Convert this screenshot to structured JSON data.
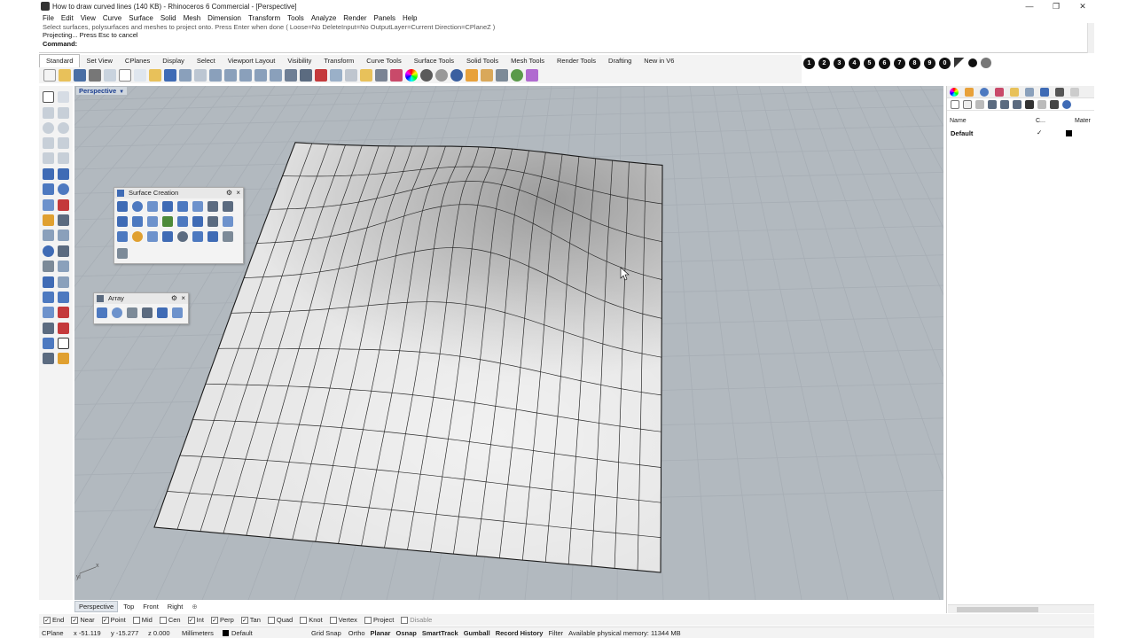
{
  "window": {
    "title": "How to draw curved lines (140 KB) - Rhinoceros 6 Commercial - [Perspective]",
    "minimize": "—",
    "restore": "❐",
    "close": "✕"
  },
  "menu": [
    "File",
    "Edit",
    "View",
    "Curve",
    "Surface",
    "Solid",
    "Mesh",
    "Dimension",
    "Transform",
    "Tools",
    "Analyze",
    "Render",
    "Panels",
    "Help"
  ],
  "command_area": {
    "history_line": "Select surfaces, polysurfaces and meshes to project onto. Press Enter when done ( Loose=No  DeleteInput=No  OutputLayer=Current  Direction=CPlaneZ )",
    "status_line": "Projecting... Press Esc to cancel",
    "prompt": "Command:"
  },
  "tabs": [
    "Standard",
    "Set View",
    "CPlanes",
    "Display",
    "Select",
    "Viewport Layout",
    "Visibility",
    "Transform",
    "Curve Tools",
    "Surface Tools",
    "Solid Tools",
    "Mesh Tools",
    "Render Tools",
    "Drafting",
    "New in V6"
  ],
  "active_tab": "Standard",
  "display_buttons": [
    "1",
    "2",
    "3",
    "4",
    "5",
    "6",
    "7",
    "8",
    "9",
    "0"
  ],
  "viewport": {
    "label": "Perspective",
    "dropdown_arrow": "▼",
    "axis_x": "x",
    "axis_y": "y"
  },
  "panels": {
    "surface_creation": {
      "title": "Surface Creation",
      "gear": "⚙",
      "close": "×"
    },
    "array": {
      "title": "Array",
      "gear": "⚙",
      "close": "×"
    }
  },
  "layers_panel": {
    "col_name": "Name",
    "col_current": "C...",
    "col_material": "Mater",
    "rows": [
      {
        "name": "Default",
        "current_mark": "✓"
      }
    ]
  },
  "view_tabs": [
    "Perspective",
    "Top",
    "Front",
    "Right"
  ],
  "active_view_tab": "Perspective",
  "view_tab_add": "⊕",
  "osnaps": [
    {
      "label": "End",
      "checked": true
    },
    {
      "label": "Near",
      "checked": true
    },
    {
      "label": "Point",
      "checked": true
    },
    {
      "label": "Mid",
      "checked": false
    },
    {
      "label": "Cen",
      "checked": false
    },
    {
      "label": "Int",
      "checked": true
    },
    {
      "label": "Perp",
      "checked": true
    },
    {
      "label": "Tan",
      "checked": true
    },
    {
      "label": "Quad",
      "checked": false
    },
    {
      "label": "Knot",
      "checked": false
    },
    {
      "label": "Vertex",
      "checked": false
    },
    {
      "label": "Project",
      "checked": false
    },
    {
      "label": "Disable",
      "checked": false,
      "dimmed": true
    }
  ],
  "check_mark": "✓",
  "status": {
    "cplane": "CPlane",
    "x": "x -51.119",
    "y": "y -15.277",
    "z": "z 0.000",
    "units": "Millimeters",
    "layer": "Default",
    "grid_snap": "Grid Snap",
    "ortho": "Ortho",
    "planar": "Planar",
    "osnap": "Osnap",
    "smarttrack": "SmartTrack",
    "gumball": "Gumball",
    "record_history": "Record History",
    "filter": "Filter",
    "memory": "Available physical memory: 11344 MB"
  },
  "colors": {
    "viewport_bg": "#b2b9bf",
    "surface": "#e6e6e6",
    "isocurve": "#2b2b2b",
    "viewport_label": "#1a3d8f"
  }
}
